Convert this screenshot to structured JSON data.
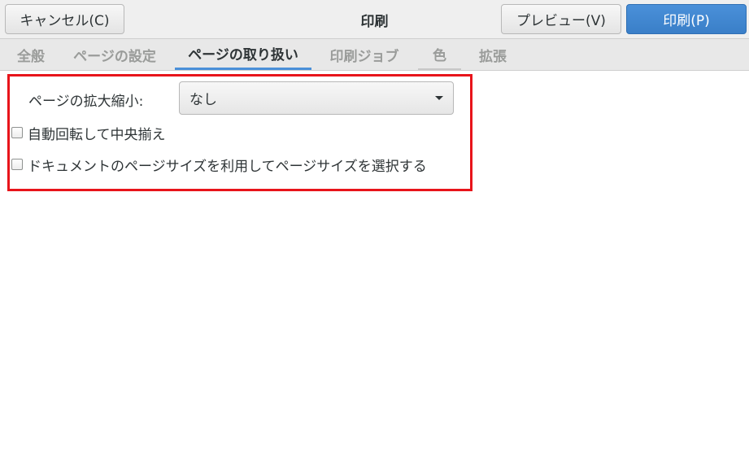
{
  "header": {
    "title": "印刷",
    "cancel_label": "キャンセル(C)",
    "preview_label": "プレビュー(V)",
    "print_label": "印刷(P)"
  },
  "tabs": [
    {
      "label": "全般",
      "active": false
    },
    {
      "label": "ページの設定",
      "active": false
    },
    {
      "label": "ページの取り扱い",
      "active": true
    },
    {
      "label": "印刷ジョブ",
      "active": false
    },
    {
      "label": "色",
      "active": false
    },
    {
      "label": "拡張",
      "active": false
    }
  ],
  "page_handling": {
    "scaling_label": "ページの拡大縮小:",
    "scaling_value": "なし",
    "auto_rotate_label": "自動回転して中央揃え",
    "auto_rotate_checked": false,
    "select_size_label": "ドキュメントのページサイズを利用してページサイズを選択する",
    "select_size_checked": false
  },
  "colors": {
    "accent": "#4a90d9",
    "highlight": "#e8141b"
  }
}
